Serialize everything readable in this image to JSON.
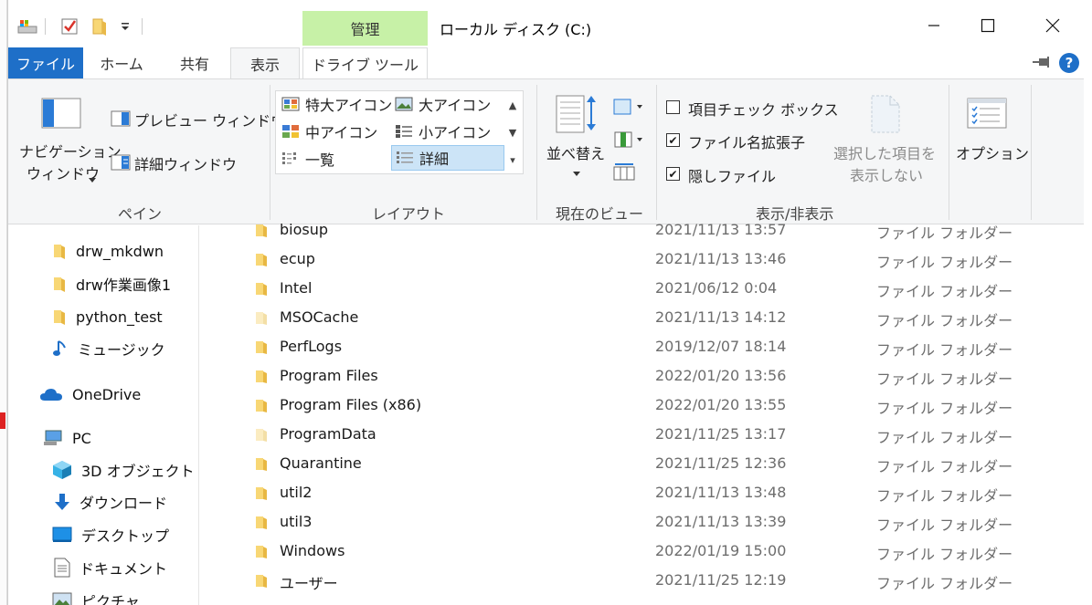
{
  "window": {
    "title": "ローカル ディスク (C:)"
  },
  "context_tab_header": "管理",
  "tabs": {
    "file": "ファイル",
    "home": "ホーム",
    "share": "共有",
    "view": "表示",
    "drive_tools": "ドライブ ツール"
  },
  "ribbon": {
    "pane": {
      "nav_pane_line1": "ナビゲーション",
      "nav_pane_line2": "ウィンドウ",
      "preview_pane": "プレビュー ウィンドウ",
      "details_pane": "詳細ウィンドウ",
      "label": "ペイン"
    },
    "layout": {
      "extra_large": "特大アイコン",
      "large": "大アイコン",
      "medium": "中アイコン",
      "small": "小アイコン",
      "list": "一覧",
      "details": "詳細",
      "label": "レイアウト"
    },
    "current_view": {
      "sort_by": "並べ替え",
      "label": "現在のビュー"
    },
    "show_hide": {
      "item_checkboxes": "項目チェック ボックス",
      "file_extensions": "ファイル名拡張子",
      "hidden_items": "隠しファイル",
      "hide_selected_line1": "選択した項目を",
      "hide_selected_line2": "表示しない",
      "label": "表示/非表示",
      "item_checkboxes_checked": false,
      "file_extensions_checked": true,
      "hidden_items_checked": true
    },
    "options": "オプション"
  },
  "nav": {
    "items": [
      {
        "label": "drw_mkdwn",
        "icon": "folder-icon"
      },
      {
        "label": "drw作業画像1",
        "icon": "folder-icon"
      },
      {
        "label": "python_test",
        "icon": "folder-icon"
      },
      {
        "label": "ミュージック",
        "icon": "music-icon"
      },
      {
        "label": "OneDrive",
        "icon": "cloud-icon"
      },
      {
        "label": "PC",
        "icon": "pc-icon"
      },
      {
        "label": "3D オブジェクト",
        "icon": "cube-icon"
      },
      {
        "label": "ダウンロード",
        "icon": "download-icon"
      },
      {
        "label": "デスクトップ",
        "icon": "desktop-icon"
      },
      {
        "label": "ドキュメント",
        "icon": "document-icon"
      },
      {
        "label": "ピクチャ",
        "icon": "picture-icon"
      }
    ]
  },
  "files": [
    {
      "name": "biosup",
      "date": "2021/11/13 13:57",
      "type": "ファイル フォルダー",
      "faded": false
    },
    {
      "name": "ecup",
      "date": "2021/11/13 13:46",
      "type": "ファイル フォルダー",
      "faded": false
    },
    {
      "name": "Intel",
      "date": "2021/06/12 0:04",
      "type": "ファイル フォルダー",
      "faded": false
    },
    {
      "name": "MSOCache",
      "date": "2021/11/13 14:12",
      "type": "ファイル フォルダー",
      "faded": true
    },
    {
      "name": "PerfLogs",
      "date": "2019/12/07 18:14",
      "type": "ファイル フォルダー",
      "faded": false
    },
    {
      "name": "Program Files",
      "date": "2022/01/20 13:56",
      "type": "ファイル フォルダー",
      "faded": false
    },
    {
      "name": "Program Files (x86)",
      "date": "2022/01/20 13:55",
      "type": "ファイル フォルダー",
      "faded": false
    },
    {
      "name": "ProgramData",
      "date": "2021/11/25 13:17",
      "type": "ファイル フォルダー",
      "faded": true
    },
    {
      "name": "Quarantine",
      "date": "2021/11/25 12:36",
      "type": "ファイル フォルダー",
      "faded": false
    },
    {
      "name": "util2",
      "date": "2021/11/13 13:48",
      "type": "ファイル フォルダー",
      "faded": false
    },
    {
      "name": "util3",
      "date": "2021/11/13 13:39",
      "type": "ファイル フォルダー",
      "faded": false
    },
    {
      "name": "Windows",
      "date": "2022/01/19 15:00",
      "type": "ファイル フォルダー",
      "faded": false
    },
    {
      "name": "ユーザー",
      "date": "2021/11/25 12:19",
      "type": "ファイル フォルダー",
      "faded": false
    }
  ],
  "colors": {
    "accent": "#1e6fc8",
    "context_tab": "#c7f1a7",
    "folder": "#f8d775",
    "selection": "#cce4f7"
  }
}
